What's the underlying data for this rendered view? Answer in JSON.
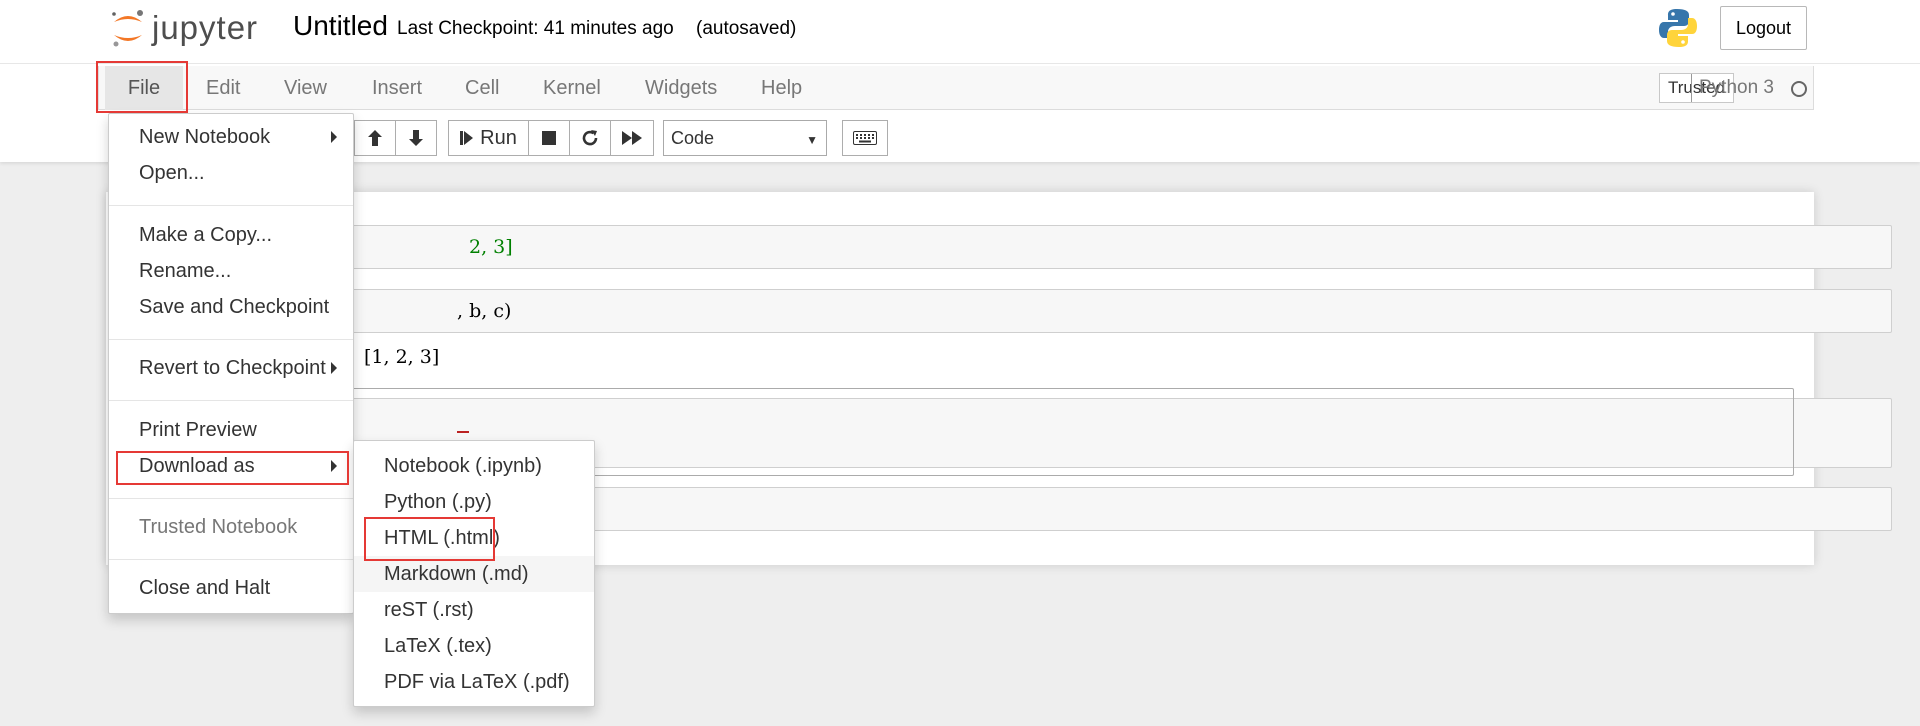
{
  "header": {
    "logo_text": "jupyter",
    "notebook_name": "Untitled",
    "checkpoint": "Last Checkpoint: 41 minutes ago",
    "autosave": "(autosaved)",
    "logout_label": "Logout"
  },
  "menubar": {
    "items": [
      "File",
      "Edit",
      "View",
      "Insert",
      "Cell",
      "Kernel",
      "Widgets",
      "Help"
    ],
    "trusted_label": "Trusted",
    "kernel_name": "Python 3"
  },
  "toolbar": {
    "run_label": "Run",
    "cell_type": "Code"
  },
  "cells": {
    "c1": "2, 3]",
    "c2": ", b, c)",
    "out2": "[1, 2, 3]"
  },
  "file_menu": {
    "new_notebook": "New Notebook",
    "open": "Open...",
    "make_copy": "Make a Copy...",
    "rename": "Rename...",
    "save_checkpoint": "Save and Checkpoint",
    "revert": "Revert to Checkpoint",
    "print_preview": "Print Preview",
    "download_as": "Download as",
    "trusted_notebook": "Trusted Notebook",
    "close_halt": "Close and Halt"
  },
  "download_menu": {
    "items": [
      "Notebook (.ipynb)",
      "Python (.py)",
      "HTML (.html)",
      "Markdown (.md)",
      "reST (.rst)",
      "LaTeX (.tex)",
      "PDF via LaTeX (.pdf)"
    ]
  },
  "colors": {
    "highlight_border": "#e53935",
    "jupyter_orange": "#f37726",
    "disabled_text": "#777777"
  }
}
